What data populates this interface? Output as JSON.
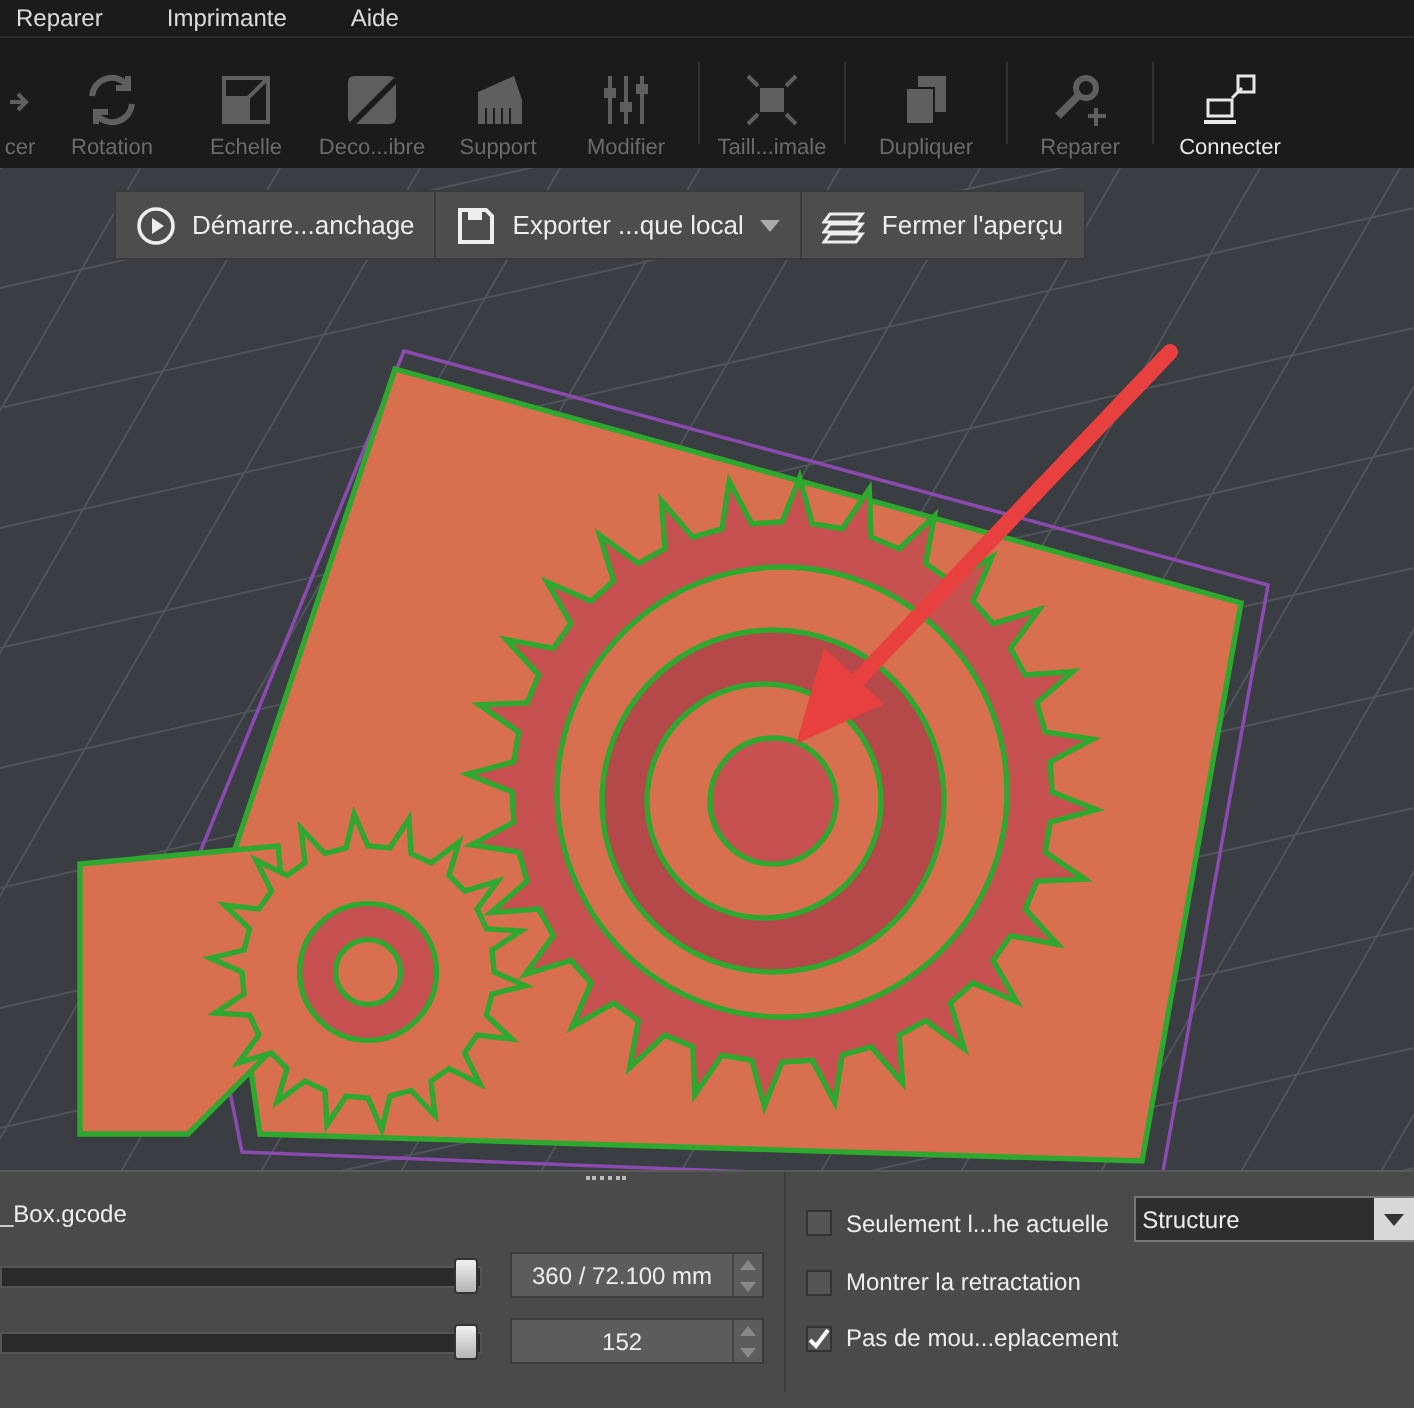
{
  "menu": [
    {
      "label": "Reparer"
    },
    {
      "label": "Imprimante"
    },
    {
      "label": "Aide"
    }
  ],
  "toolbar": [
    {
      "label": "cer",
      "disabled": true
    },
    {
      "label": "Rotation",
      "disabled": true
    },
    {
      "label": "Echelle",
      "disabled": true
    },
    {
      "label": "Deco...ibre",
      "disabled": true
    },
    {
      "label": "Support",
      "disabled": true
    },
    {
      "label": "Modifier",
      "disabled": true,
      "separator_after": true
    },
    {
      "label": "Taill...imale",
      "disabled": true,
      "separator_after": true
    },
    {
      "label": "Dupliquer",
      "disabled": true,
      "separator_after": true
    },
    {
      "label": "Reparer",
      "disabled": true,
      "separator_after": true
    },
    {
      "label": "Connecter",
      "disabled": false
    }
  ],
  "preview_toolbar": [
    {
      "label": "Démarre...anchage",
      "dropdown": false
    },
    {
      "label": "Exporter ...que local",
      "dropdown": true
    },
    {
      "label": "Fermer l'aperçu",
      "dropdown": false
    }
  ],
  "panel": {
    "file_name": "_Box.gcode",
    "sliders": [
      {
        "level": 0.98,
        "value": "360 / 72.100 mm"
      },
      {
        "level": 0.98,
        "value": "152"
      }
    ],
    "options": [
      {
        "label": "Seulement l...he actuelle",
        "checked": false
      },
      {
        "label": "Montrer la retractation",
        "checked": false
      },
      {
        "label": "Pas de mou...eplacement",
        "checked": true
      }
    ],
    "view_mode": {
      "value": "Structure"
    }
  }
}
